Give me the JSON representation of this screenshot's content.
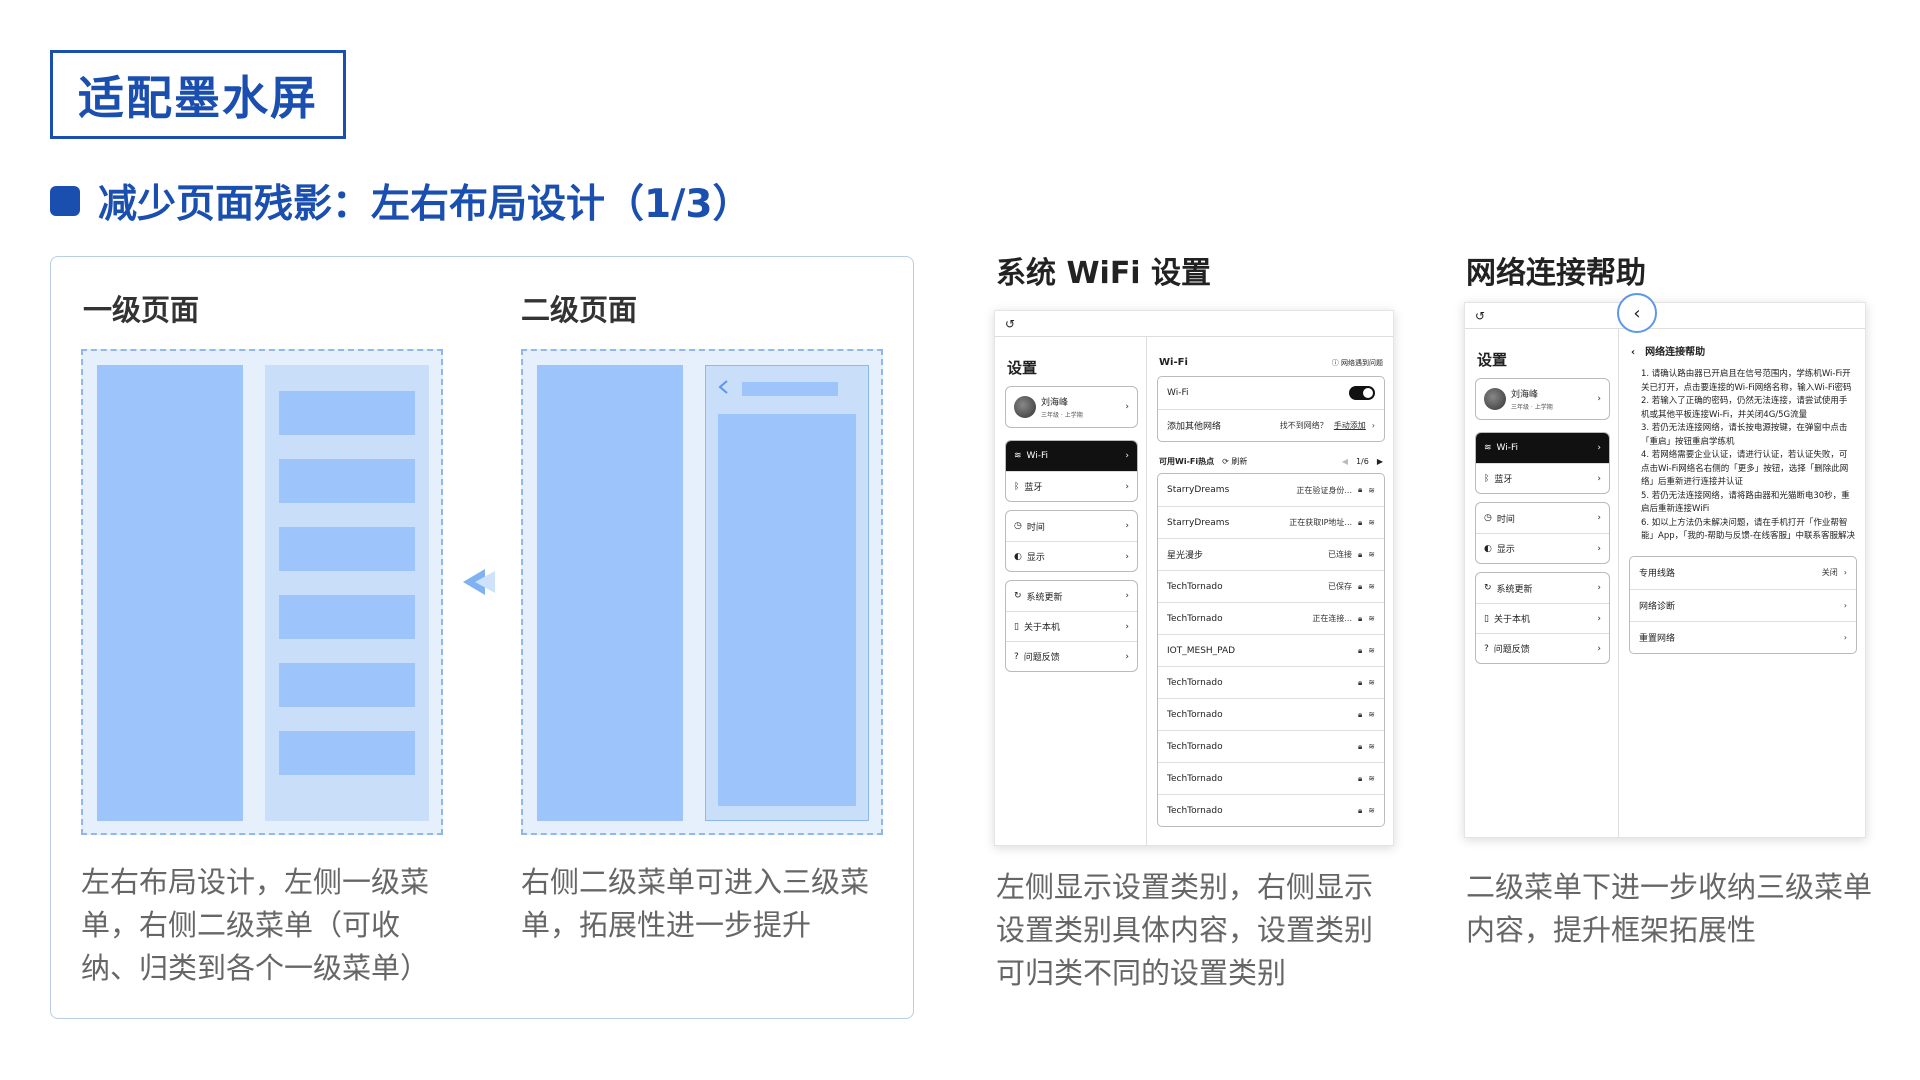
{
  "title": "适配墨水屏",
  "subtitle": "减少页面残影：左右布局设计（1/3）",
  "left_panel": {
    "level1_heading": "一级页面",
    "level2_heading": "二级页面",
    "level1_desc": "左右布局设计，左侧一级菜单，右侧二级菜单（可收纳、归类到各个一级菜单）",
    "level2_desc": "右侧二级菜单可进入三级菜单，拓展性进一步提升"
  },
  "wifi_col": {
    "heading": "系统 WiFi 设置",
    "desc": "左侧显示设置类别，右侧显示设置类别具体内容，设置类别可归类不同的设置类别",
    "back_icon": "↺",
    "sidebar": {
      "title": "设置",
      "user_name": "刘海峰",
      "user_sub": "三年级 · 上学期",
      "items": [
        {
          "label": "Wi-Fi",
          "icon": "wifi-icon"
        },
        {
          "label": "蓝牙",
          "icon": "bluetooth-icon"
        },
        {
          "label": "时间",
          "icon": "clock-icon"
        },
        {
          "label": "显示",
          "icon": "display-icon"
        },
        {
          "label": "系统更新",
          "icon": "update-icon"
        },
        {
          "label": "关于本机",
          "icon": "device-icon"
        },
        {
          "label": "问题反馈",
          "icon": "help-icon"
        }
      ]
    },
    "main": {
      "title": "Wi-Fi",
      "trouble": "网络遇到问题",
      "wifi_label": "Wi-Fi",
      "add_label": "添加其他网络",
      "add_hint": "找不到网络？",
      "add_link": "手动添加",
      "hotspots_label": "可用Wi-Fi热点",
      "refresh_label": "刷新",
      "page": "1/6",
      "networks": [
        {
          "name": "StarryDreams",
          "status": "正在验证身份..."
        },
        {
          "name": "StarryDreams",
          "status": "正在获取IP地址..."
        },
        {
          "name": "星光漫步",
          "status": "已连接"
        },
        {
          "name": "TechTornado",
          "status": "已保存"
        },
        {
          "name": "TechTornado",
          "status": "正在连接..."
        },
        {
          "name": "IOT_MESH_PAD",
          "status": ""
        },
        {
          "name": "TechTornado",
          "status": ""
        },
        {
          "name": "TechTornado",
          "status": ""
        },
        {
          "name": "TechTornado",
          "status": ""
        },
        {
          "name": "TechTornado",
          "status": ""
        },
        {
          "name": "TechTornado",
          "status": ""
        }
      ]
    }
  },
  "help_col": {
    "heading": "网络连接帮助",
    "desc": "二级菜单下进一步收纳三级菜单内容，提升框架拓展性",
    "sidebar": {
      "title": "设置",
      "user_name": "刘海峰",
      "user_sub": "三年级 · 上学期",
      "items": [
        {
          "label": "Wi-Fi"
        },
        {
          "label": "蓝牙"
        },
        {
          "label": "时间"
        },
        {
          "label": "显示"
        },
        {
          "label": "系统更新"
        },
        {
          "label": "关于本机"
        },
        {
          "label": "问题反馈"
        }
      ]
    },
    "main": {
      "title": "网络连接帮助",
      "steps": [
        "1. 请确认路由器已开启且在信号范围内，学练机Wi-Fi开关已打开，点击要连接的Wi-Fi网络名称，输入Wi-Fi密码",
        "2. 若输入了正确的密码，仍然无法连接，请尝试使用手机或其他平板连接Wi-Fi，并关闭4G/5G流量",
        "3. 若仍无法连接网络，请长按电源按键，在弹窗中点击「重启」按钮重启学练机",
        "4. 若网络需要企业认证，请进行认证，若认证失败，可点击Wi-Fi网络名右侧的「更多」按钮，选择「删除此网络」后重新进行连接并认证",
        "5. 若仍无法连接网络，请将路由器和光猫断电30秒，重启后重新连接WiFi",
        "6. 如以上方法仍未解决问题，请在手机打开「作业帮智能」App，「我的-帮助与反馈-在线客服」中联系客服解决"
      ],
      "options": [
        {
          "label": "专用线路",
          "value": "关闭"
        },
        {
          "label": "网络诊断",
          "value": ""
        },
        {
          "label": "重置网络",
          "value": ""
        }
      ]
    }
  }
}
